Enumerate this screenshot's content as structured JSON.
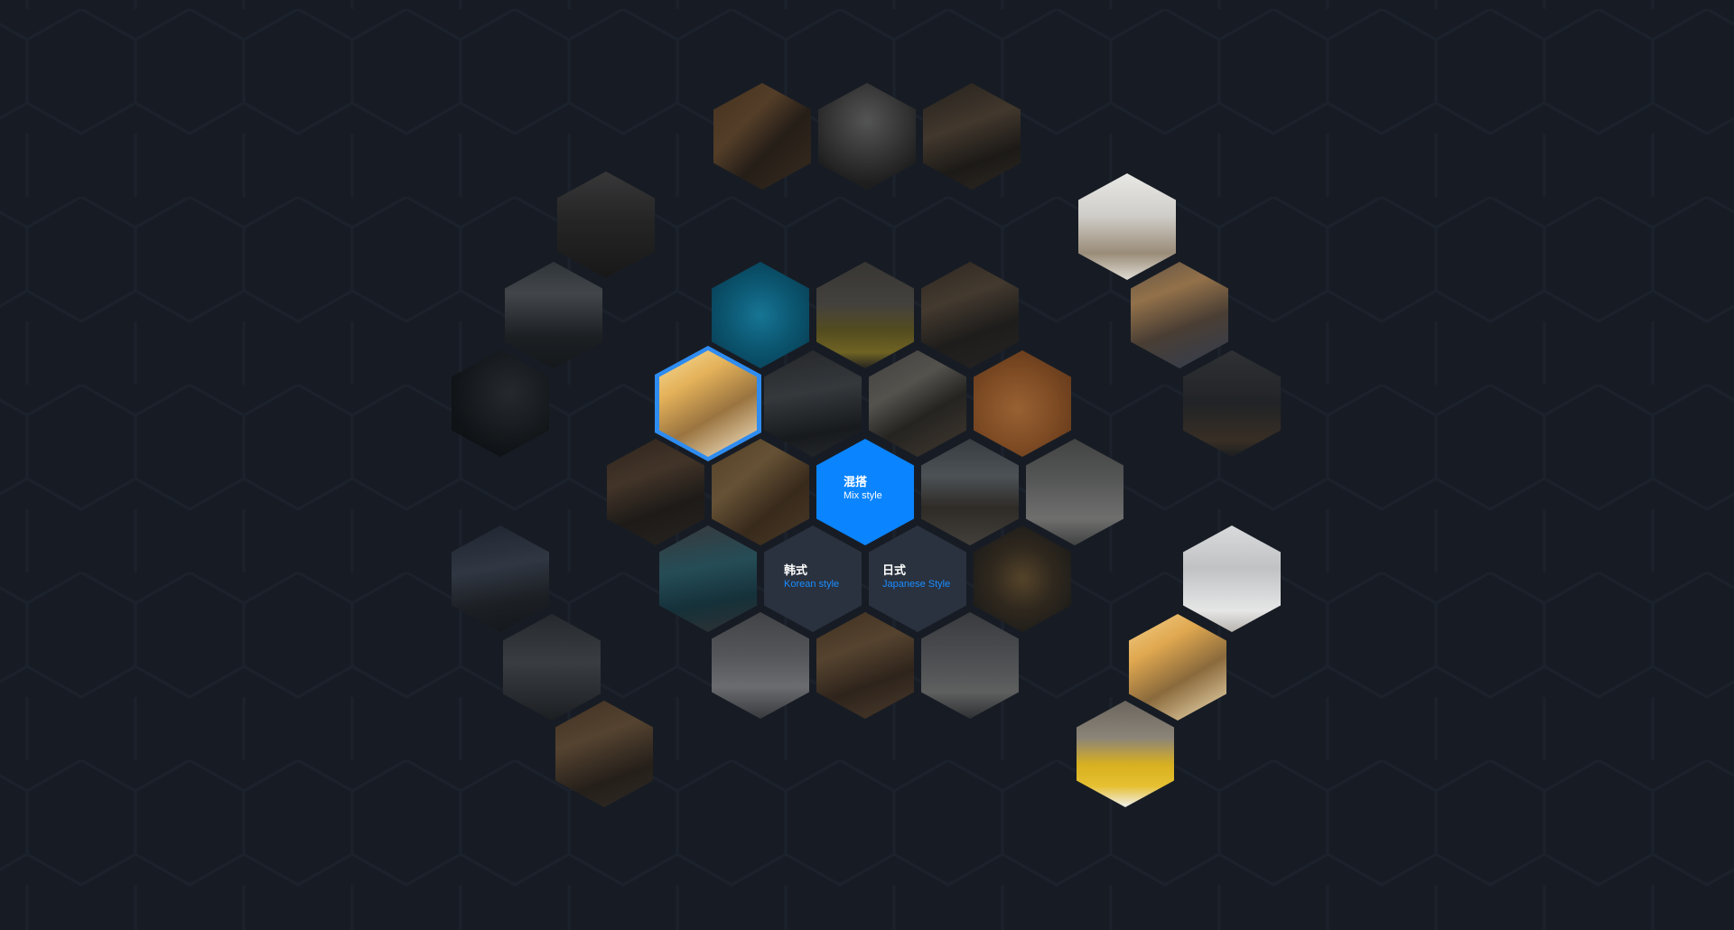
{
  "colors": {
    "background": "#171c24",
    "pattern_stroke": "#1f2530",
    "accent": "#0a84ff",
    "ring": "#2f8cf0",
    "label_bg": "#2a323f"
  },
  "styles": [
    {
      "zh": "混搭",
      "en": "Mix style",
      "active": true
    },
    {
      "zh": "韩式",
      "en": "Korean style",
      "active": false
    },
    {
      "zh": "日式",
      "en": "Japanese Style",
      "active": false
    }
  ]
}
